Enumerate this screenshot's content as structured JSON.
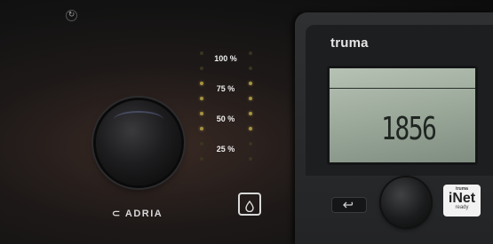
{
  "adria_panel": {
    "brand": "ADRIA",
    "screw_symbol": "↻",
    "level_labels": [
      "100 %",
      "75 %",
      "50 %",
      "25 %"
    ],
    "level_dots_lit_fraction": 0.5,
    "water_button_icon": "water-drop-icon"
  },
  "truma_panel": {
    "brand": "truma",
    "display_value": "1856",
    "back_button_icon": "return-arrow-icon",
    "badge": {
      "top": "truma",
      "main": "iNet",
      "bottom": "ready"
    }
  },
  "colors": {
    "lcd_background": "#a3b0a2",
    "label_text": "#eeeeee",
    "led_lit": "#a69340"
  }
}
